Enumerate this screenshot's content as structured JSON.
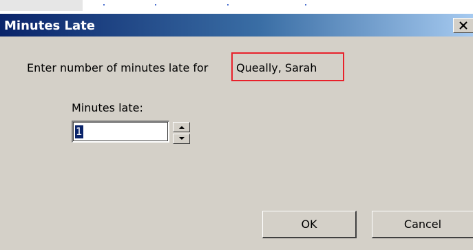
{
  "dialog": {
    "title": "Minutes Late",
    "close_glyph": "✕",
    "prompt": "Enter number of minutes late for",
    "student_name": "Queally, Sarah",
    "field_label": "Minutes late:",
    "minutes_value": "1",
    "ok_label": "OK",
    "cancel_label": "Cancel"
  },
  "colors": {
    "titlebar_start": "#0a246a",
    "titlebar_end": "#a6caf0",
    "dialog_face": "#d4d0c8",
    "highlight_box": "#e8202a"
  },
  "icons": {
    "close": "close-icon",
    "spin_up": "chevron-up-icon",
    "spin_down": "chevron-down-icon"
  }
}
